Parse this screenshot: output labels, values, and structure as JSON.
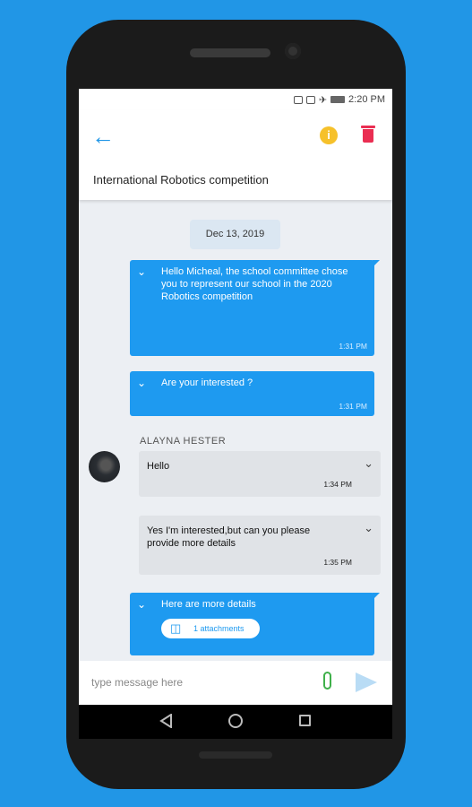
{
  "status_bar": {
    "time": "2:20 PM"
  },
  "header": {
    "title": "International Robotics competition"
  },
  "date_separator": "Dec 13, 2019",
  "messages_out": [
    {
      "text": "Hello Micheal, the school committee chose you to represent our school in the 2020 Robotics competition",
      "time": "1:31 PM"
    },
    {
      "text": "Are your interested ?",
      "time": "1:31 PM"
    }
  ],
  "incoming": {
    "sender": "ALAYNA HESTER",
    "messages": [
      {
        "text": "Hello",
        "time": "1:34 PM"
      },
      {
        "text": "Yes I'm interested,but can you please provide more details",
        "time": "1:35 PM"
      }
    ]
  },
  "last_message": {
    "text": "Here are more details",
    "attachment_label": "1 attachments"
  },
  "composer": {
    "placeholder": "type message here"
  },
  "colors": {
    "accent": "#2196e6",
    "bubble_out": "#1e9af0",
    "info": "#f6c12b",
    "delete": "#ea2e52",
    "attach": "#3fb04a"
  },
  "icons": [
    "back-arrow-icon",
    "info-icon",
    "trash-icon",
    "chevron-down-icon",
    "paperclip-icon",
    "send-icon"
  ]
}
